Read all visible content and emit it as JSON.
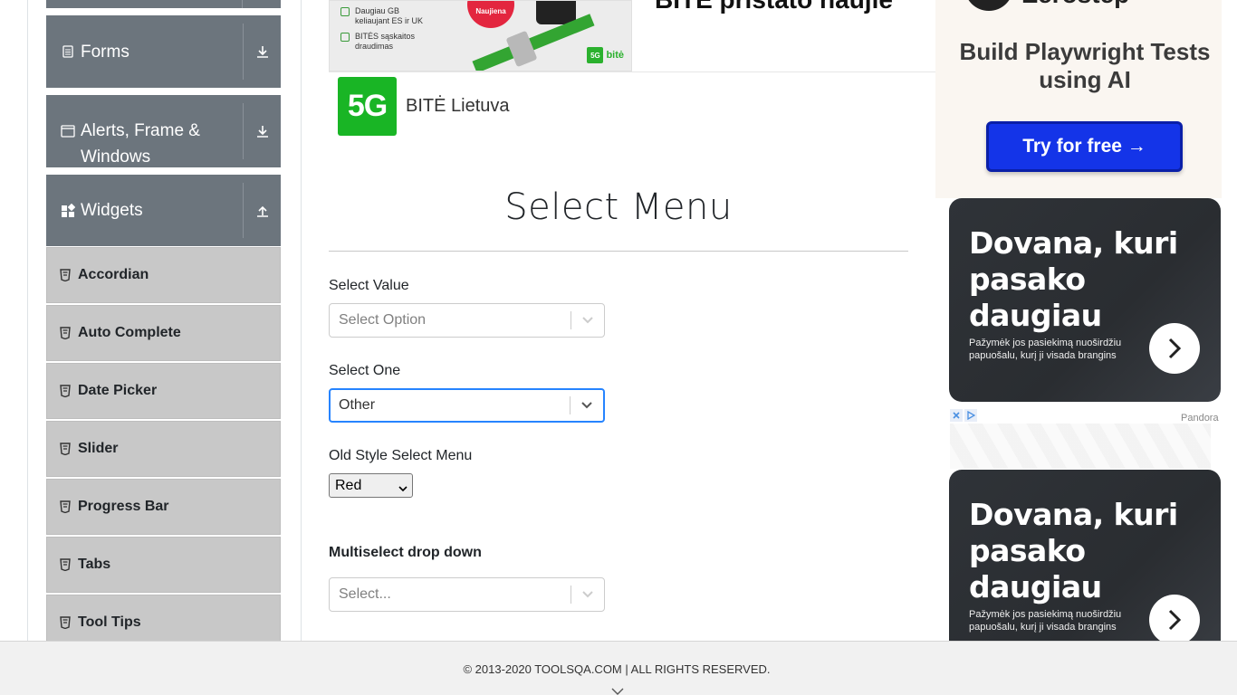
{
  "sidebar": {
    "groups": [
      {
        "label": "Forms",
        "icon": "document-icon",
        "toggle": "download-icon"
      },
      {
        "label": "Alerts, Frame & Windows",
        "label_line1": "Alerts, Frame &",
        "label_line2": "Windows",
        "icon": "window-icon",
        "toggle": "download-icon"
      },
      {
        "label": "Widgets",
        "icon": "widgets-icon",
        "toggle": "upload-icon"
      }
    ],
    "items": [
      {
        "label": "Accordian"
      },
      {
        "label": "Auto Complete"
      },
      {
        "label": "Date Picker"
      },
      {
        "label": "Slider"
      },
      {
        "label": "Progress Bar"
      },
      {
        "label": "Tabs"
      },
      {
        "label": "Tool Tips"
      }
    ]
  },
  "ads": {
    "top_banner": {
      "line1": "Daugiau GB keliaujant ES ir UK",
      "line2": "BITĖS sąskaitos draudimas",
      "badge": "Naujiena",
      "logo_badge": "5G",
      "logo_text": "bitė",
      "headline": "BITĖ pristato naujie"
    },
    "brand": {
      "logo": "5G",
      "name": "BITĖ Lietuva"
    },
    "playwright": {
      "top_text": "Zerostep",
      "heading": "Build Playwright Tests using AI",
      "cta": "Try for free →"
    },
    "pandora_cards": [
      {
        "heading_line1": "Dovana, kuri",
        "heading_line2": "pasako daugiau",
        "body": "Pažymėk jos pasiekimą nuoširdžiu papuošalu, kurį ji visada brangins"
      },
      {
        "heading_line1": "Dovana, kuri",
        "heading_line2": "pasako daugiau",
        "body": "Pažymėk jos pasiekimą nuoširdžiu papuošalu, kurį ji visada brangins"
      }
    ],
    "pandora_label": "Pandora"
  },
  "main": {
    "title": "Select Menu",
    "select_value": {
      "label": "Select Value",
      "placeholder": "Select Option"
    },
    "select_one": {
      "label": "Select One",
      "value": "Other"
    },
    "old_style": {
      "label": "Old Style Select Menu",
      "value": "Red"
    },
    "multiselect": {
      "label": "Multiselect drop down",
      "placeholder": "Select..."
    }
  },
  "footer": {
    "copyright": "© 2013-2020 TOOLSQA.COM | ALL RIGHTS RESERVED."
  },
  "colors": {
    "sidebar_group": "#6c757d",
    "sidebar_item": "#c8c8c8",
    "focus": "#2684ff",
    "cta": "#1434e8",
    "brand_green": "#19b525"
  }
}
